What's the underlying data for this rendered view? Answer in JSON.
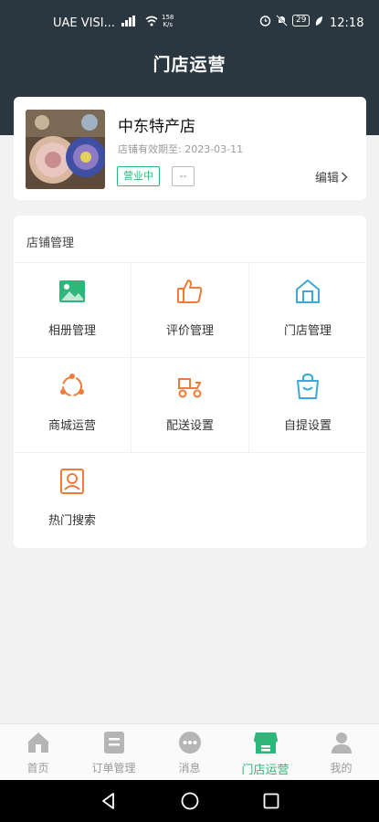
{
  "status_bar": {
    "carrier": "UAE VISI...",
    "net_speed_value": "158",
    "net_speed_unit": "K/s",
    "battery": "29",
    "time": "12:18"
  },
  "header": {
    "title": "门店运营"
  },
  "store": {
    "name": "中东特产店",
    "valid_until_label": "店铺有效期至:",
    "valid_until_date": "2023-03-11",
    "status_badge": "营业中",
    "secondary_badge": "--",
    "edit_label": "编辑"
  },
  "management": {
    "section_title": "店铺管理",
    "items": [
      {
        "label": "相册管理",
        "icon": "album-icon",
        "color": "#2fb67a"
      },
      {
        "label": "评价管理",
        "icon": "thumbs-up-icon",
        "color": "#f07a3a"
      },
      {
        "label": "门店管理",
        "icon": "store-house-icon",
        "color": "#3aa8dc"
      },
      {
        "label": "商城运营",
        "icon": "mall-operation-icon",
        "color": "#f07a3a"
      },
      {
        "label": "配送设置",
        "icon": "delivery-scooter-icon",
        "color": "#f07a3a"
      },
      {
        "label": "自提设置",
        "icon": "shopping-bag-icon",
        "color": "#3aa8dc"
      },
      {
        "label": "热门搜索",
        "icon": "hot-search-icon",
        "color": "#f07a3a"
      }
    ]
  },
  "tabbar": {
    "active_color": "#2fb67a",
    "items": [
      {
        "label": "首页",
        "icon": "home-icon"
      },
      {
        "label": "订单管理",
        "icon": "orders-icon"
      },
      {
        "label": "消息",
        "icon": "message-icon"
      },
      {
        "label": "门店运营",
        "icon": "store-operation-icon"
      },
      {
        "label": "我的",
        "icon": "profile-icon"
      }
    ]
  }
}
